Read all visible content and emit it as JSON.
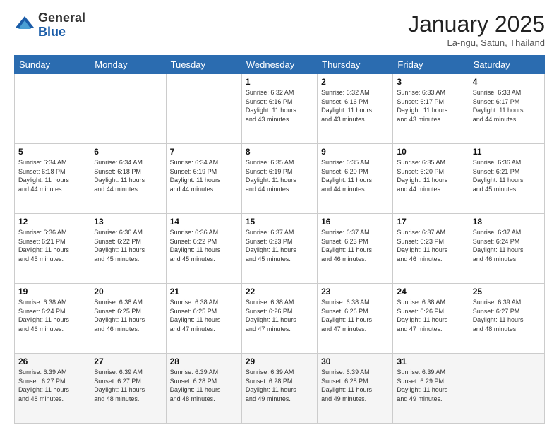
{
  "logo": {
    "general": "General",
    "blue": "Blue"
  },
  "title": "January 2025",
  "location": "La-ngu, Satun, Thailand",
  "days_of_week": [
    "Sunday",
    "Monday",
    "Tuesday",
    "Wednesday",
    "Thursday",
    "Friday",
    "Saturday"
  ],
  "weeks": [
    [
      {
        "num": "",
        "info": ""
      },
      {
        "num": "",
        "info": ""
      },
      {
        "num": "",
        "info": ""
      },
      {
        "num": "1",
        "info": "Sunrise: 6:32 AM\nSunset: 6:16 PM\nDaylight: 11 hours\nand 43 minutes."
      },
      {
        "num": "2",
        "info": "Sunrise: 6:32 AM\nSunset: 6:16 PM\nDaylight: 11 hours\nand 43 minutes."
      },
      {
        "num": "3",
        "info": "Sunrise: 6:33 AM\nSunset: 6:17 PM\nDaylight: 11 hours\nand 43 minutes."
      },
      {
        "num": "4",
        "info": "Sunrise: 6:33 AM\nSunset: 6:17 PM\nDaylight: 11 hours\nand 44 minutes."
      }
    ],
    [
      {
        "num": "5",
        "info": "Sunrise: 6:34 AM\nSunset: 6:18 PM\nDaylight: 11 hours\nand 44 minutes."
      },
      {
        "num": "6",
        "info": "Sunrise: 6:34 AM\nSunset: 6:18 PM\nDaylight: 11 hours\nand 44 minutes."
      },
      {
        "num": "7",
        "info": "Sunrise: 6:34 AM\nSunset: 6:19 PM\nDaylight: 11 hours\nand 44 minutes."
      },
      {
        "num": "8",
        "info": "Sunrise: 6:35 AM\nSunset: 6:19 PM\nDaylight: 11 hours\nand 44 minutes."
      },
      {
        "num": "9",
        "info": "Sunrise: 6:35 AM\nSunset: 6:20 PM\nDaylight: 11 hours\nand 44 minutes."
      },
      {
        "num": "10",
        "info": "Sunrise: 6:35 AM\nSunset: 6:20 PM\nDaylight: 11 hours\nand 44 minutes."
      },
      {
        "num": "11",
        "info": "Sunrise: 6:36 AM\nSunset: 6:21 PM\nDaylight: 11 hours\nand 45 minutes."
      }
    ],
    [
      {
        "num": "12",
        "info": "Sunrise: 6:36 AM\nSunset: 6:21 PM\nDaylight: 11 hours\nand 45 minutes."
      },
      {
        "num": "13",
        "info": "Sunrise: 6:36 AM\nSunset: 6:22 PM\nDaylight: 11 hours\nand 45 minutes."
      },
      {
        "num": "14",
        "info": "Sunrise: 6:36 AM\nSunset: 6:22 PM\nDaylight: 11 hours\nand 45 minutes."
      },
      {
        "num": "15",
        "info": "Sunrise: 6:37 AM\nSunset: 6:23 PM\nDaylight: 11 hours\nand 45 minutes."
      },
      {
        "num": "16",
        "info": "Sunrise: 6:37 AM\nSunset: 6:23 PM\nDaylight: 11 hours\nand 46 minutes."
      },
      {
        "num": "17",
        "info": "Sunrise: 6:37 AM\nSunset: 6:23 PM\nDaylight: 11 hours\nand 46 minutes."
      },
      {
        "num": "18",
        "info": "Sunrise: 6:37 AM\nSunset: 6:24 PM\nDaylight: 11 hours\nand 46 minutes."
      }
    ],
    [
      {
        "num": "19",
        "info": "Sunrise: 6:38 AM\nSunset: 6:24 PM\nDaylight: 11 hours\nand 46 minutes."
      },
      {
        "num": "20",
        "info": "Sunrise: 6:38 AM\nSunset: 6:25 PM\nDaylight: 11 hours\nand 46 minutes."
      },
      {
        "num": "21",
        "info": "Sunrise: 6:38 AM\nSunset: 6:25 PM\nDaylight: 11 hours\nand 47 minutes."
      },
      {
        "num": "22",
        "info": "Sunrise: 6:38 AM\nSunset: 6:26 PM\nDaylight: 11 hours\nand 47 minutes."
      },
      {
        "num": "23",
        "info": "Sunrise: 6:38 AM\nSunset: 6:26 PM\nDaylight: 11 hours\nand 47 minutes."
      },
      {
        "num": "24",
        "info": "Sunrise: 6:38 AM\nSunset: 6:26 PM\nDaylight: 11 hours\nand 47 minutes."
      },
      {
        "num": "25",
        "info": "Sunrise: 6:39 AM\nSunset: 6:27 PM\nDaylight: 11 hours\nand 48 minutes."
      }
    ],
    [
      {
        "num": "26",
        "info": "Sunrise: 6:39 AM\nSunset: 6:27 PM\nDaylight: 11 hours\nand 48 minutes."
      },
      {
        "num": "27",
        "info": "Sunrise: 6:39 AM\nSunset: 6:27 PM\nDaylight: 11 hours\nand 48 minutes."
      },
      {
        "num": "28",
        "info": "Sunrise: 6:39 AM\nSunset: 6:28 PM\nDaylight: 11 hours\nand 48 minutes."
      },
      {
        "num": "29",
        "info": "Sunrise: 6:39 AM\nSunset: 6:28 PM\nDaylight: 11 hours\nand 49 minutes."
      },
      {
        "num": "30",
        "info": "Sunrise: 6:39 AM\nSunset: 6:28 PM\nDaylight: 11 hours\nand 49 minutes."
      },
      {
        "num": "31",
        "info": "Sunrise: 6:39 AM\nSunset: 6:29 PM\nDaylight: 11 hours\nand 49 minutes."
      },
      {
        "num": "",
        "info": ""
      }
    ]
  ]
}
